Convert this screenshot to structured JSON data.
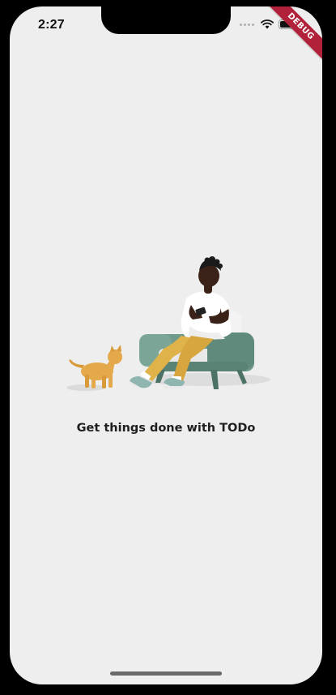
{
  "status_bar": {
    "time": "2:27",
    "icons": [
      "signal-dots-icon",
      "wifi-icon",
      "battery-icon"
    ]
  },
  "debug_banner": {
    "label": "DEBUG"
  },
  "onboarding": {
    "illustration": "person-on-armchair-with-phone-and-cat",
    "tagline": "Get things done with TODo"
  },
  "colors": {
    "background": "#eeeeee",
    "text": "#1f1f1f",
    "sofa": "#6f9a8c",
    "pants": "#e0b24a",
    "shirt": "#ffffff",
    "cat": "#e3a94a",
    "debug_banner": "#b1213a"
  }
}
